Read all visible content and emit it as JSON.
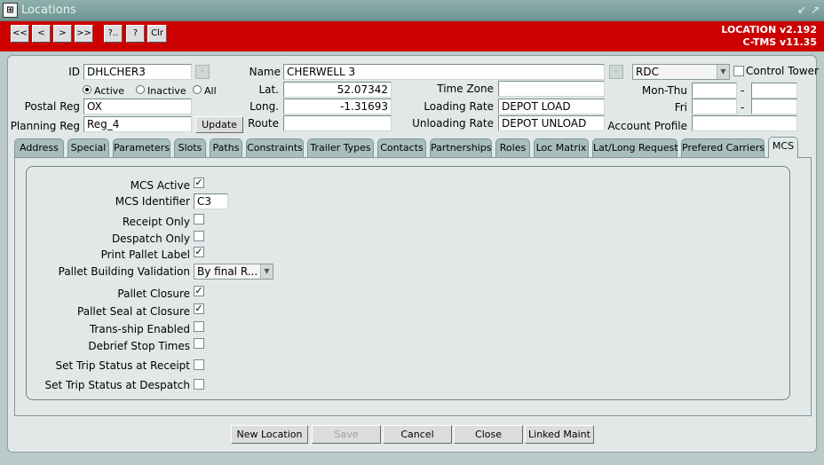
{
  "window": {
    "title": "Locations"
  },
  "toolbar": {
    "nav": [
      "<<",
      "<",
      ">",
      ">>",
      "?..",
      "?",
      "Clr"
    ],
    "version_line1": "LOCATION v2.192",
    "version_line2": "C-TMS v11.35"
  },
  "header": {
    "id_label": "ID",
    "id_value": "DHLCHER3",
    "name_label": "Name",
    "name_value": "CHERWELL 3",
    "type_value": "RDC",
    "control_tower_label": "Control Tower",
    "status": {
      "active": "Active",
      "inactive": "Inactive",
      "all": "All",
      "selected": "Active"
    },
    "lat_label": "Lat.",
    "lat_value": "52.07342",
    "long_label": "Long.",
    "long_value": "-1.31693",
    "route_label": "Route",
    "route_value": "",
    "timezone_label": "Time Zone",
    "timezone_value": "",
    "loading_rate_label": "Loading Rate",
    "loading_rate_value": "DEPOT LOAD",
    "unloading_rate_label": "Unloading Rate",
    "unloading_rate_value": "DEPOT UNLOAD",
    "postal_reg_label": "Postal Reg",
    "postal_reg_value": "OX",
    "planning_reg_label": "Planning Reg",
    "planning_reg_value": "Reg_4",
    "update_label": "Update",
    "mon_thu_label": "Mon-Thu",
    "fri_label": "Fri",
    "dash": "-",
    "account_profile_label": "Account Profile",
    "account_profile_value": ""
  },
  "tabs": [
    "Address",
    "Special",
    "Parameters",
    "Slots",
    "Paths",
    "Constraints",
    "Trailer Types",
    "Contacts",
    "Partnerships",
    "Roles",
    "Loc Matrix",
    "Lat/Long Request",
    "Prefered Carriers",
    "MCS"
  ],
  "active_tab": "MCS",
  "mcs": {
    "mcs_active": {
      "label": "MCS Active",
      "checked": true
    },
    "mcs_identifier": {
      "label": "MCS Identifier",
      "value": "C3"
    },
    "receipt_only": {
      "label": "Receipt Only",
      "checked": false
    },
    "despatch_only": {
      "label": "Despatch Only",
      "checked": false
    },
    "print_pallet_label": {
      "label": "Print Pallet Label",
      "checked": true
    },
    "pallet_building_validation": {
      "label": "Pallet Building Validation",
      "value": "By final R..."
    },
    "pallet_closure": {
      "label": "Pallet Closure",
      "checked": true
    },
    "pallet_seal_at_closure": {
      "label": "Pallet Seal at Closure",
      "checked": true
    },
    "trans_ship_enabled": {
      "label": "Trans-ship Enabled",
      "checked": false
    },
    "debrief_stop_times": {
      "label": "Debrief Stop Times",
      "checked": false
    },
    "set_trip_status_receipt": {
      "label": "Set Trip Status at Receipt",
      "checked": false
    },
    "set_trip_status_despatch": {
      "label": "Set Trip Status at Despatch",
      "checked": false
    }
  },
  "footer": {
    "new_location": "New Location",
    "save": "Save",
    "cancel": "Cancel",
    "close": "Close",
    "linked_maint": "Linked Maint"
  },
  "icons": {
    "app": "app-icon",
    "minimize": "minimize-icon",
    "maximize": "maximize-icon",
    "dropdown": "chevron-down-icon",
    "check": "check-mark-icon"
  },
  "colors": {
    "toolbar_red": "#cc0000",
    "panel": "#e2e8e8",
    "tab": "#a8bdbc",
    "titlebar": "#7fa3a0"
  }
}
